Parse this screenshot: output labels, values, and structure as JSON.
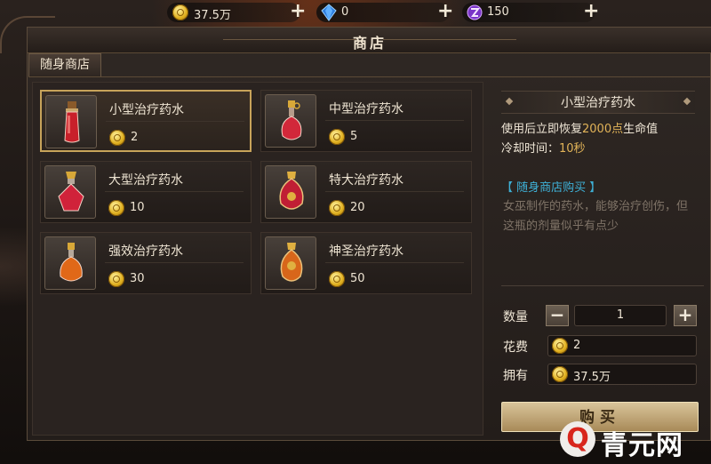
{
  "currencies": [
    {
      "icon": "gold-coin-icon",
      "value": "37.5万"
    },
    {
      "icon": "blue-diamond-icon",
      "value": "0"
    },
    {
      "icon": "purple-crystal-icon",
      "value": "150"
    }
  ],
  "window": {
    "title": "商店",
    "tab": "随身商店"
  },
  "items": [
    {
      "name": "小型治疗药水",
      "price": "2",
      "selected": true
    },
    {
      "name": "中型治疗药水",
      "price": "5"
    },
    {
      "name": "大型治疗药水",
      "price": "10"
    },
    {
      "name": "特大治疗药水",
      "price": "20"
    },
    {
      "name": "强效治疗药水",
      "price": "30"
    },
    {
      "name": "神圣治疗药水",
      "price": "50"
    }
  ],
  "detail": {
    "name": "小型治疗药水",
    "effect_prefix": "使用后立即恢复",
    "effect_value": "2000点",
    "effect_suffix": "生命值",
    "cooldown_label": "冷却时间：",
    "cooldown_value": "10秒",
    "source": "【 随身商店购买 】",
    "description": "女巫制作的药水，能够治疗创伤，但这瓶的剂量似乎有点少"
  },
  "purchase": {
    "quantity_label": "数量",
    "quantity": "1",
    "minus": "−",
    "plus": "+",
    "cost_label": "花费",
    "cost": "2",
    "own_label": "拥有",
    "own": "37.5万",
    "buy_label": "购买"
  },
  "watermark": {
    "symbol": "Q",
    "text": "青元网"
  },
  "colors": {
    "gold_text": "#e1b358",
    "source_text": "#3eb0d6",
    "selected_border": "#c7a35a"
  }
}
